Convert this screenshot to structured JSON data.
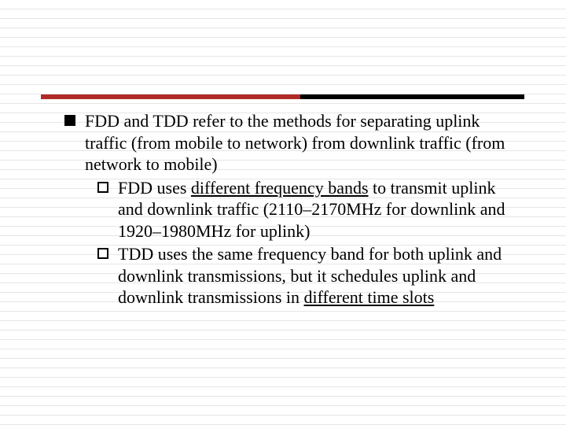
{
  "slide": {
    "bullet": {
      "text_parts": [
        "FDD and TDD refer to the methods for separating uplink traffic (from mobile to network) from downlink traffic (from network to mobile)"
      ]
    },
    "sub1": {
      "prefix": "FDD uses ",
      "underlined": "different frequency bands",
      "suffix": " to transmit uplink and downlink traffic (2110–2170MHz for downlink and 1920–1980MHz for uplink)"
    },
    "sub2": {
      "prefix": "TDD uses the same frequency band for both uplink and downlink transmissions, but it schedules uplink and downlink transmissions in ",
      "underlined": "different time slots",
      "suffix": ""
    }
  }
}
